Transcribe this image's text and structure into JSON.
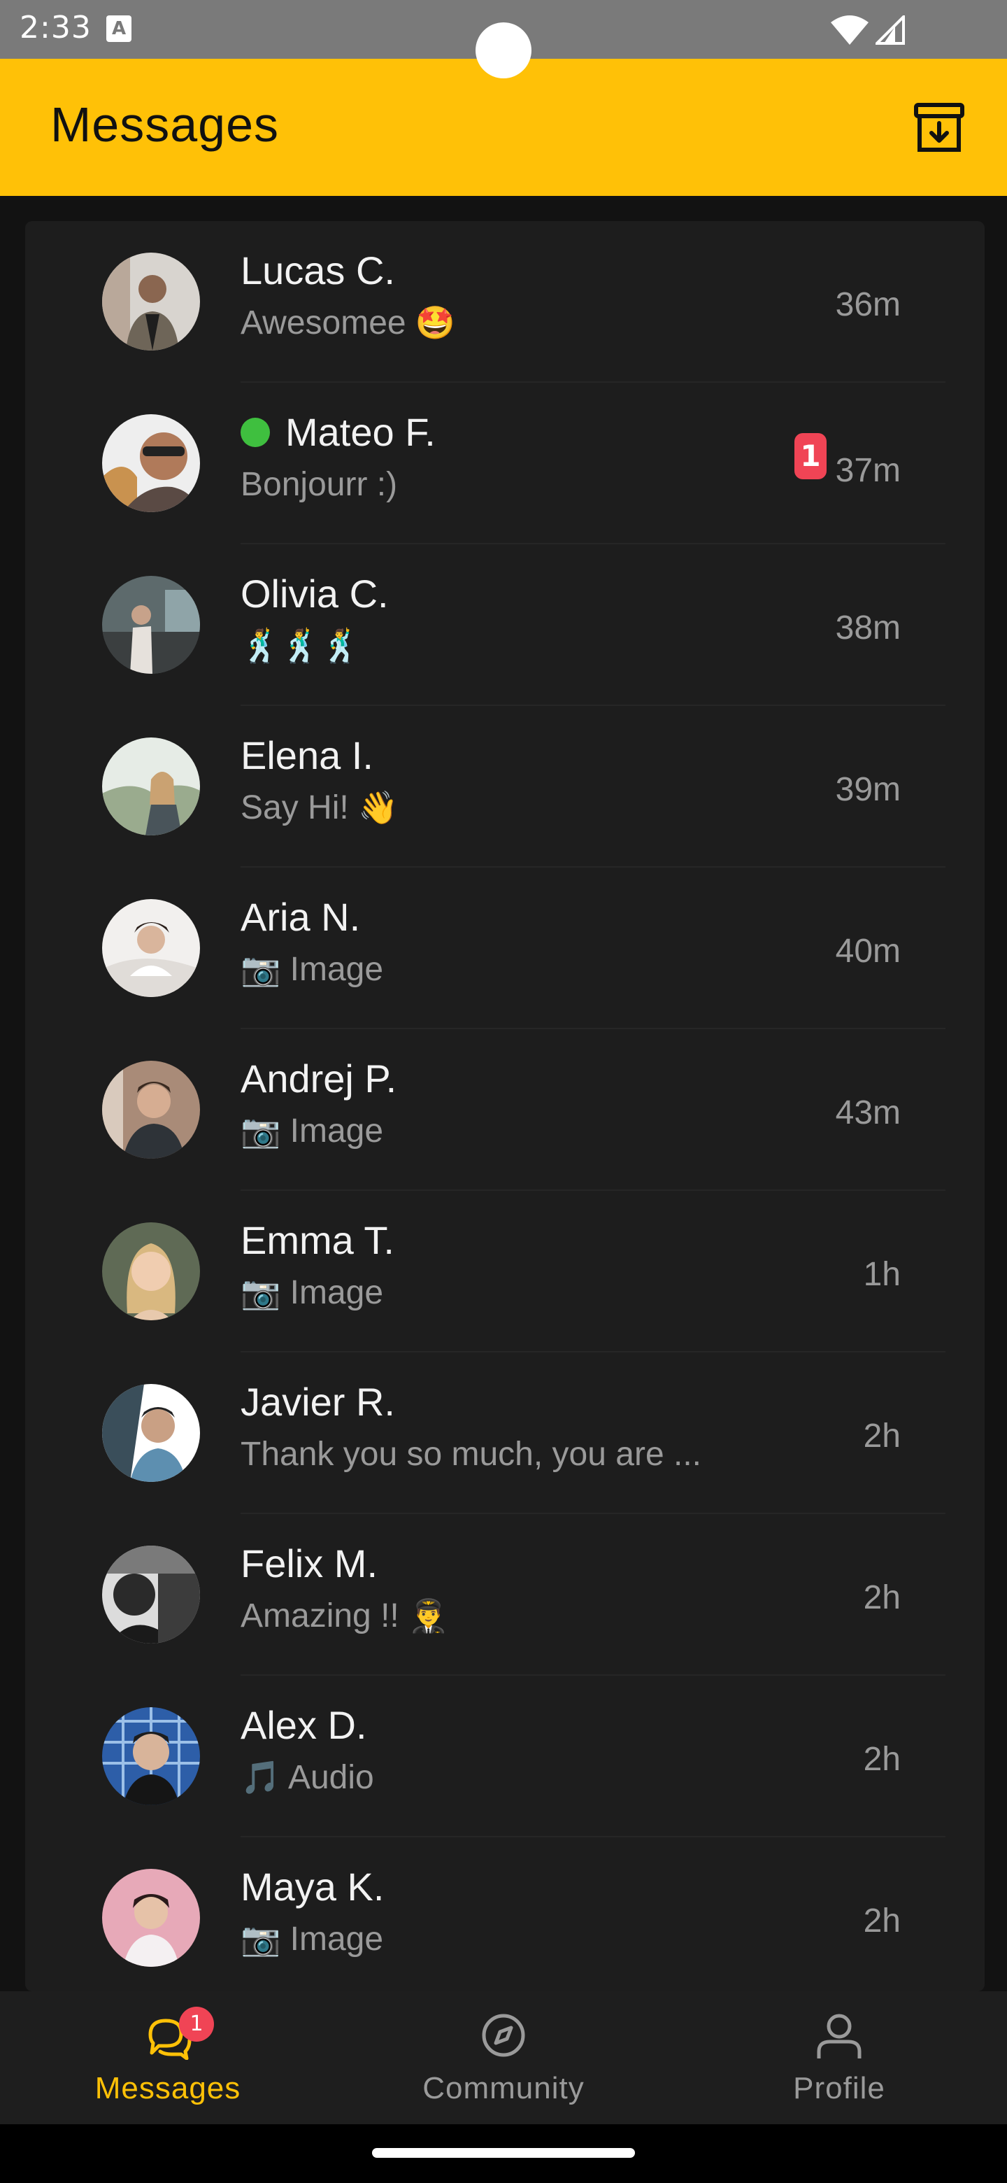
{
  "status_bar": {
    "time": "2:33",
    "notification_letter": "A"
  },
  "header": {
    "title": "Messages",
    "archive_icon": "archive-download-icon"
  },
  "colors": {
    "accent": "#ffc107",
    "badge": "#f04455",
    "online": "#3fbf3f"
  },
  "conversations": [
    {
      "name": "Lucas C.",
      "preview": "Awesomee",
      "emoji": "🤩",
      "time": "36m"
    },
    {
      "name": "Mateo F.",
      "preview": "Bonjourr :)",
      "emoji": "",
      "time": "37m",
      "online": true,
      "unread": "1"
    },
    {
      "name": "Olivia C.",
      "preview": "",
      "emoji": "🕺🕺🕺",
      "time": "38m"
    },
    {
      "name": "Elena I.",
      "preview": "Say Hi!",
      "emoji": "👋",
      "time": "39m"
    },
    {
      "name": "Aria N.",
      "preview": "Image",
      "emoji_before": "📷",
      "time": "40m"
    },
    {
      "name": "Andrej P.",
      "preview": "Image",
      "emoji_before": "📷",
      "time": "43m"
    },
    {
      "name": "Emma T.",
      "preview": "Image",
      "emoji_before": "📷",
      "time": "1h"
    },
    {
      "name": "Javier R.",
      "preview": "Thank you so much, you are ...",
      "emoji": "",
      "time": "2h"
    },
    {
      "name": "Felix M.",
      "preview": "Amazing !!",
      "emoji": "👨‍✈️",
      "time": "2h"
    },
    {
      "name": "Alex D.",
      "preview": "Audio",
      "emoji_before": "🎵",
      "time": "2h"
    },
    {
      "name": "Maya K.",
      "preview": "Image",
      "emoji_before": "📷",
      "time": "2h"
    }
  ],
  "bottom_nav": {
    "messages": {
      "label": "Messages",
      "badge": "1",
      "icon": "chat-bubbles-icon"
    },
    "community": {
      "label": "Community",
      "icon": "compass-icon"
    },
    "profile": {
      "label": "Profile",
      "icon": "person-icon"
    }
  }
}
